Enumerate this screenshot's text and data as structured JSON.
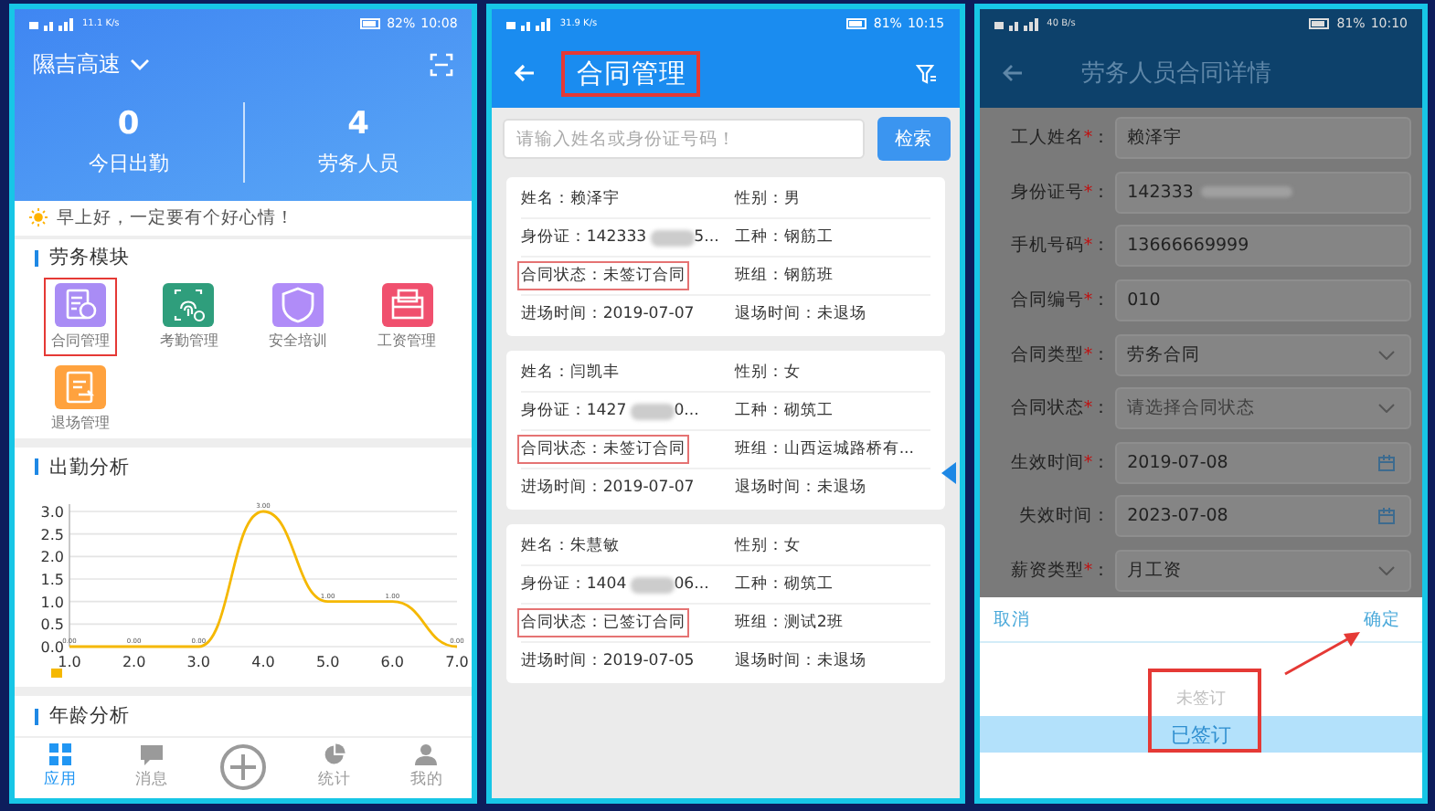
{
  "home_screen": {
    "status_bar": {
      "net_speed": "11.1",
      "speed_unit": "K/s",
      "battery": "82%",
      "time": "10:08"
    },
    "project": "隰吉高速",
    "stats": [
      {
        "value": "0",
        "label": "今日出勤"
      },
      {
        "value": "4",
        "label": "劳务人员"
      }
    ],
    "greeting": "早上好，一定要有个好心情！",
    "modules_title": "劳务模块",
    "modules": [
      {
        "label": "合同管理",
        "kind": "contract",
        "color": "#a98cf5",
        "highlighted": true
      },
      {
        "label": "考勤管理",
        "kind": "fingerprint",
        "color": "#2f9e7c",
        "highlighted": false
      },
      {
        "label": "安全培训",
        "kind": "shield",
        "color": "#b08cf8",
        "highlighted": false
      },
      {
        "label": "工资管理",
        "kind": "wallet",
        "color": "#f0506e",
        "highlighted": false
      },
      {
        "label": "退场管理",
        "kind": "exit",
        "color": "#ffa23e",
        "highlighted": false
      }
    ],
    "attendance": {
      "title": "出勤分析",
      "chart_data": {
        "type": "line",
        "x": [
          1,
          2,
          3,
          4,
          5,
          6,
          7
        ],
        "xlim": [
          1,
          7
        ],
        "ylim": [
          0,
          3
        ],
        "series": [
          {
            "color": "#f5b800",
            "values": [
              0,
              0,
              0,
              3,
              1,
              1,
              0
            ],
            "value_labels": [
              "0.00",
              "0.00",
              "0.00",
              "3.00",
              "1.00",
              "1.00",
              "0.00"
            ]
          }
        ],
        "grid": true,
        "xticks": [
          {
            "value": 1,
            "label": "1.0"
          },
          {
            "value": 2,
            "label": "2.0"
          },
          {
            "value": 3,
            "label": "3.0"
          },
          {
            "value": 4,
            "label": "4.0"
          },
          {
            "value": 5,
            "label": "5.0"
          },
          {
            "value": 6,
            "label": "6.0"
          },
          {
            "value": 7,
            "label": "7.0"
          }
        ],
        "yticks": [
          {
            "value": 0,
            "label": "0.0"
          },
          {
            "value": 0.5,
            "label": "0.5"
          },
          {
            "value": 1,
            "label": "1.0"
          },
          {
            "value": 1.5,
            "label": "1.5"
          },
          {
            "value": 2,
            "label": "2.0"
          },
          {
            "value": 2.5,
            "label": "2.5"
          },
          {
            "value": 3,
            "label": "3.0"
          }
        ],
        "data_labels": true
      }
    },
    "age_section": {
      "title": "年龄分析"
    },
    "tab_bar": [
      {
        "kind": "apps",
        "label": "应用",
        "selected": true
      },
      {
        "kind": "message",
        "label": "消息",
        "selected": false
      },
      {
        "kind": "add",
        "selected": false
      },
      {
        "kind": "stats",
        "label": "统计",
        "selected": false
      },
      {
        "kind": "user",
        "label": "我的",
        "selected": false
      }
    ]
  },
  "contract_list_screen": {
    "status_bar": {
      "net_speed": "31.9",
      "speed_unit": "K/s",
      "battery": "81%",
      "time": "10:15"
    },
    "title": "合同管理",
    "title_highlighted": true,
    "search": {
      "placeholder": "请输入姓名或身份证号码！",
      "button": "检索"
    },
    "cards": [
      {
        "rows": [
          {
            "highlighted": false,
            "cells": [
              {
                "kind": "plain",
                "text": "姓名：赖泽宇"
              },
              {
                "kind": "plain",
                "text": "性别：男"
              }
            ]
          },
          {
            "highlighted": false,
            "cells": [
              {
                "kind": "masked",
                "text": "身份证：142333",
                "tail": "5..."
              },
              {
                "kind": "plain",
                "text": "工种：钢筋工"
              }
            ]
          },
          {
            "highlighted": true,
            "cells": [
              {
                "kind": "plain",
                "text": "合同状态：未签订合同"
              },
              {
                "kind": "plain",
                "text": "班组：钢筋班"
              }
            ]
          },
          {
            "highlighted": false,
            "cells": [
              {
                "kind": "plain",
                "text": "进场时间：2019-07-07"
              },
              {
                "kind": "plain",
                "text": "退场时间：未退场"
              }
            ]
          }
        ]
      },
      {
        "rows": [
          {
            "highlighted": false,
            "cells": [
              {
                "kind": "plain",
                "text": "姓名：闫凯丰"
              },
              {
                "kind": "plain",
                "text": "性别：女"
              }
            ]
          },
          {
            "highlighted": false,
            "cells": [
              {
                "kind": "masked",
                "text": "身份证：1427",
                "tail": "0..."
              },
              {
                "kind": "plain",
                "text": "工种：砌筑工"
              }
            ]
          },
          {
            "highlighted": true,
            "cells": [
              {
                "kind": "plain",
                "text": "合同状态：未签订合同"
              },
              {
                "kind": "plain",
                "text": "班组：山西运城路桥有..."
              }
            ]
          },
          {
            "highlighted": false,
            "cells": [
              {
                "kind": "plain",
                "text": "进场时间：2019-07-07"
              },
              {
                "kind": "plain",
                "text": "退场时间：未退场"
              }
            ]
          }
        ]
      },
      {
        "rows": [
          {
            "highlighted": false,
            "cells": [
              {
                "kind": "plain",
                "text": "姓名：朱慧敏"
              },
              {
                "kind": "plain",
                "text": "性别：女"
              }
            ]
          },
          {
            "highlighted": false,
            "cells": [
              {
                "kind": "masked",
                "text": "身份证：1404",
                "tail": "06..."
              },
              {
                "kind": "plain",
                "text": "工种：砌筑工"
              }
            ]
          },
          {
            "highlighted": true,
            "cells": [
              {
                "kind": "plain",
                "text": "合同状态：已签订合同"
              },
              {
                "kind": "plain",
                "text": "班组：测试2班"
              }
            ]
          },
          {
            "highlighted": false,
            "cells": [
              {
                "kind": "plain",
                "text": "进场时间：2019-07-05"
              },
              {
                "kind": "plain",
                "text": "退场时间：未退场"
              }
            ]
          }
        ]
      }
    ]
  },
  "contract_detail_screen": {
    "status_bar": {
      "net_speed": "40",
      "speed_unit": "B/s",
      "battery": "81%",
      "time": "10:10"
    },
    "title": "劳务人员合同详情",
    "fields": [
      {
        "label": "工人姓名",
        "required_mark": "*",
        "colon": "：",
        "kind": "text",
        "value": "赖泽宇"
      },
      {
        "label": "身份证号",
        "required_mark": "*",
        "colon": "：",
        "kind": "masked",
        "value": "142333"
      },
      {
        "label": "手机号码",
        "required_mark": "*",
        "colon": "：",
        "kind": "text",
        "value": "13666669999"
      },
      {
        "label": "合同编号",
        "required_mark": "*",
        "colon": "：",
        "kind": "text",
        "value": "010"
      },
      {
        "label": "合同类型",
        "required_mark": "*",
        "colon": "：",
        "kind": "select",
        "value": "劳务合同"
      },
      {
        "label": "合同状态",
        "required_mark": "*",
        "colon": "：",
        "kind": "select",
        "placeholder": "请选择合同状态"
      },
      {
        "label": "生效时间",
        "required_mark": "*",
        "colon": "：",
        "kind": "date",
        "value": "2019-07-08"
      },
      {
        "label": "失效时间",
        "colon": "：",
        "kind": "date",
        "value": "2023-07-08"
      },
      {
        "label": "薪资类型",
        "required_mark": "*",
        "colon": "：",
        "kind": "select",
        "value": "月工资"
      }
    ],
    "picker": {
      "cancel": "取消",
      "confirm": "确定",
      "highlighted": true,
      "options": [
        {
          "label": "未签订",
          "selected": false
        },
        {
          "label": "已签订",
          "selected": true
        }
      ]
    }
  }
}
